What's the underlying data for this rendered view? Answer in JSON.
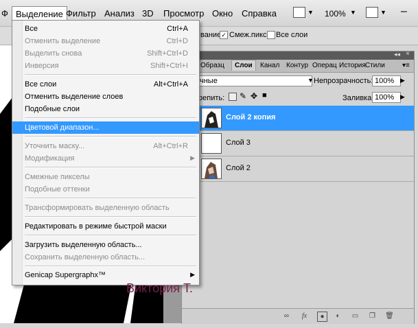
{
  "menubar": {
    "items": [
      "Выделение",
      "Фильтр",
      "Анализ",
      "3D",
      "Просмотр",
      "Окно",
      "Справка"
    ],
    "zoom": "100%"
  },
  "optbar": {
    "partial_label": "вание",
    "smooth_label": "Смеж.пикс",
    "all_layers_label": "Все слои"
  },
  "panel": {
    "tabs": [
      "Образц",
      "Слои",
      "Канал",
      "Контур",
      "Операц",
      "История",
      "Стили"
    ],
    "blend_mode": "чные",
    "opacity_label": "Непрозрачность:",
    "opacity_value": "100%",
    "lock_label": "репить:",
    "fill_label": "Заливка:",
    "fill_value": "100%",
    "layers": [
      {
        "name": "Слой 2 копия"
      },
      {
        "name": "Слой 3"
      },
      {
        "name": "Слой 2"
      }
    ]
  },
  "menu": {
    "items": [
      {
        "label": "Все",
        "shortcut": "Ctrl+A",
        "disabled": false
      },
      {
        "label": "Отменить выделение",
        "shortcut": "Ctrl+D",
        "disabled": true
      },
      {
        "label": "Выделить снова",
        "shortcut": "Shift+Ctrl+D",
        "disabled": true
      },
      {
        "label": "Инверсия",
        "shortcut": "Shift+Ctrl+I",
        "disabled": true
      },
      {
        "label": "Все слои",
        "shortcut": "Alt+Ctrl+A",
        "disabled": false
      },
      {
        "label": "Отменить выделение слоев",
        "shortcut": "",
        "disabled": false
      },
      {
        "label": "Подобные слои",
        "shortcut": "",
        "disabled": false
      },
      {
        "label": "Цветовой диапазон...",
        "shortcut": "",
        "disabled": false,
        "highlighted": true
      },
      {
        "label": "Уточнить маску...",
        "shortcut": "Alt+Ctrl+R",
        "disabled": true
      },
      {
        "label": "Модификация",
        "shortcut": "",
        "disabled": true,
        "submenu": true
      },
      {
        "label": "Смежные пикселы",
        "shortcut": "",
        "disabled": true
      },
      {
        "label": "Подобные оттенки",
        "shortcut": "",
        "disabled": true
      },
      {
        "label": "Трансформировать выделенную область",
        "shortcut": "",
        "disabled": true
      },
      {
        "label": "Редактировать в режиме быстрой маски",
        "shortcut": "",
        "disabled": false
      },
      {
        "label": "Загрузить выделенную область...",
        "shortcut": "",
        "disabled": false
      },
      {
        "label": "Сохранить выделенную область...",
        "shortcut": "",
        "disabled": true
      },
      {
        "label": "Genicap Supergraphx™",
        "shortcut": "",
        "disabled": false,
        "submenu": true
      }
    ]
  },
  "signature": "Виктория Т.",
  "colors": {
    "highlight": "#3399ff",
    "signature": "#7a1f4a"
  }
}
